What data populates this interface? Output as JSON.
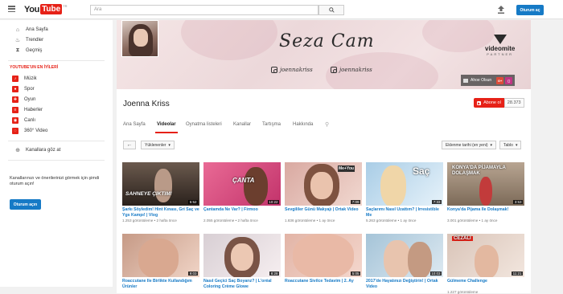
{
  "header": {
    "logo_you": "You",
    "logo_tube": "Tube",
    "logo_region": "TR",
    "search_placeholder": "Ara",
    "signin_label": "Oturum aç"
  },
  "sidebar": {
    "items": [
      {
        "label": "Ana Sayfa",
        "icon": "home-icon"
      },
      {
        "label": "Trendler",
        "icon": "flame-icon"
      },
      {
        "label": "Geçmiş",
        "icon": "history-icon"
      }
    ],
    "best_heading": "YOUTUBE'UN EN İYİLERİ",
    "best_items": [
      {
        "label": "Müzik",
        "icon": "music-icon"
      },
      {
        "label": "Spor",
        "icon": "sports-icon"
      },
      {
        "label": "Oyun",
        "icon": "gaming-icon"
      },
      {
        "label": "Haberler",
        "icon": "news-icon"
      },
      {
        "label": "Canlı",
        "icon": "live-icon"
      },
      {
        "label": "360° Video",
        "icon": "360-icon"
      }
    ],
    "browse_channels": "Kanallara göz at",
    "signin_prompt": "Kanallarınızı ve önerilerinizi görmek için şimdi oturum açın!",
    "signin_button": "Oturum açın"
  },
  "banner": {
    "script_title": "Seza Cam",
    "insta1": "joennakriss",
    "insta2": "joennakriss",
    "sponsor_name": "videomite",
    "sponsor_sub": "PARTNER",
    "about_label": "Ahoe Olsun",
    "link_g": "G+"
  },
  "channel": {
    "name": "Joenna Kriss",
    "subscribe_label": "Abone ol",
    "subscriber_count": "28.373",
    "tabs": [
      "Ana Sayfa",
      "Videolar",
      "Oynatma listeleri",
      "Kanallar",
      "Tartışma",
      "Hakkında"
    ],
    "active_tab": "Videolar"
  },
  "filters": {
    "uploads_label": "Yüklenenler",
    "sort_label": "Eklenme tarihi (en yeni)",
    "view_label": "Tablo"
  },
  "videos": [
    {
      "title": "Şarkı Söyledim! Hint Kınası, Gri Saç ve Ygs Kampı! | Vlog",
      "views": "1.253 görüntüleme",
      "age": "2 hafta önce",
      "duration": "5:52",
      "overlay": "SAHNEYE ÇIKTIM!"
    },
    {
      "title": "Çantamda Ne Var? | Firmoo",
      "views": "2.055 görüntüleme",
      "age": "2 hafta önce",
      "duration": "10:22",
      "overlay": "ÇANTA"
    },
    {
      "title": "Sevgililer Günü Makyajı | Ortak Video",
      "views": "1.836 görüntüleme",
      "age": "1 ay önce",
      "duration": "7:09",
      "overlay": "Me+You"
    },
    {
      "title": "Saçlarımı Nasıl Uzattım? | Irresistible Me",
      "views": "5.263 görüntüleme",
      "age": "1 ay önce",
      "duration": "7:33",
      "overlay": "Saç"
    },
    {
      "title": "Konya'da Pijama İle Dolaşmak!",
      "views": "3.001 görüntüleme",
      "age": "1 ay önce",
      "duration": "3:53",
      "overlay": "KONYA'DA PİJAMAYLA DOLAŞMAK"
    },
    {
      "title": "Roaccutane İle Birlikte Kullandığım Ürünler",
      "views": "",
      "age": "",
      "duration": "9:03",
      "overlay": ""
    },
    {
      "title": "Nasıl Geçici Saç Boyarız? | L'oréal Coloring Crème Glowe",
      "views": "",
      "age": "",
      "duration": "8:28",
      "overlay": ""
    },
    {
      "title": "Roaccutane Sivilce Tedavim | 2. Ay",
      "views": "",
      "age": "",
      "duration": "5:05",
      "overlay": ""
    },
    {
      "title": "2017'de Hayatınızı Değiştirin! | Ortak Video",
      "views": "",
      "age": "",
      "duration": "10:03",
      "overlay": ""
    },
    {
      "title": "Gülmeme Challenge",
      "views": "1.227 görüntüleme",
      "age": "",
      "duration": "11:21",
      "overlay": "CEZALI"
    }
  ]
}
